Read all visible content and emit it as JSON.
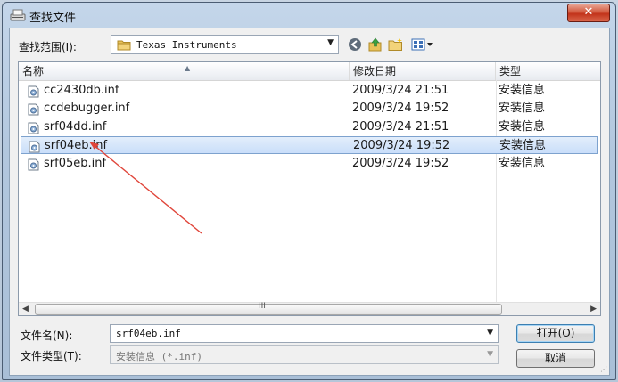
{
  "window": {
    "title": "查找文件",
    "close_glyph": "✕"
  },
  "lookin": {
    "label": "查找范围(I):",
    "value": "Texas Instruments"
  },
  "columns": {
    "name": "名称",
    "date": "修改日期",
    "type": "类型"
  },
  "files": [
    {
      "name": "cc2430db.inf",
      "date": "2009/3/24 21:51",
      "type": "安装信息"
    },
    {
      "name": "ccdebugger.inf",
      "date": "2009/3/24 19:52",
      "type": "安装信息"
    },
    {
      "name": "srf04dd.inf",
      "date": "2009/3/24 21:51",
      "type": "安装信息"
    },
    {
      "name": "srf04eb.inf",
      "date": "2009/3/24 19:52",
      "type": "安装信息"
    },
    {
      "name": "srf05eb.inf",
      "date": "2009/3/24 19:52",
      "type": "安装信息"
    }
  ],
  "selected_index": 3,
  "scroll": {
    "grip": "III"
  },
  "filename": {
    "label": "文件名(N):",
    "value": "srf04eb.inf"
  },
  "filetype": {
    "label": "文件类型(T):",
    "value": "安装信息 (*.inf)"
  },
  "buttons": {
    "open": "打开(O)",
    "cancel": "取消"
  },
  "icons": {
    "back": "back-icon",
    "up": "up-folder-icon",
    "new_folder": "new-folder-icon",
    "views": "views-menu-icon"
  },
  "colors": {
    "selection": "#c9defa",
    "annotation_arrow": "#e0453a",
    "close_button": "#c2331a"
  }
}
